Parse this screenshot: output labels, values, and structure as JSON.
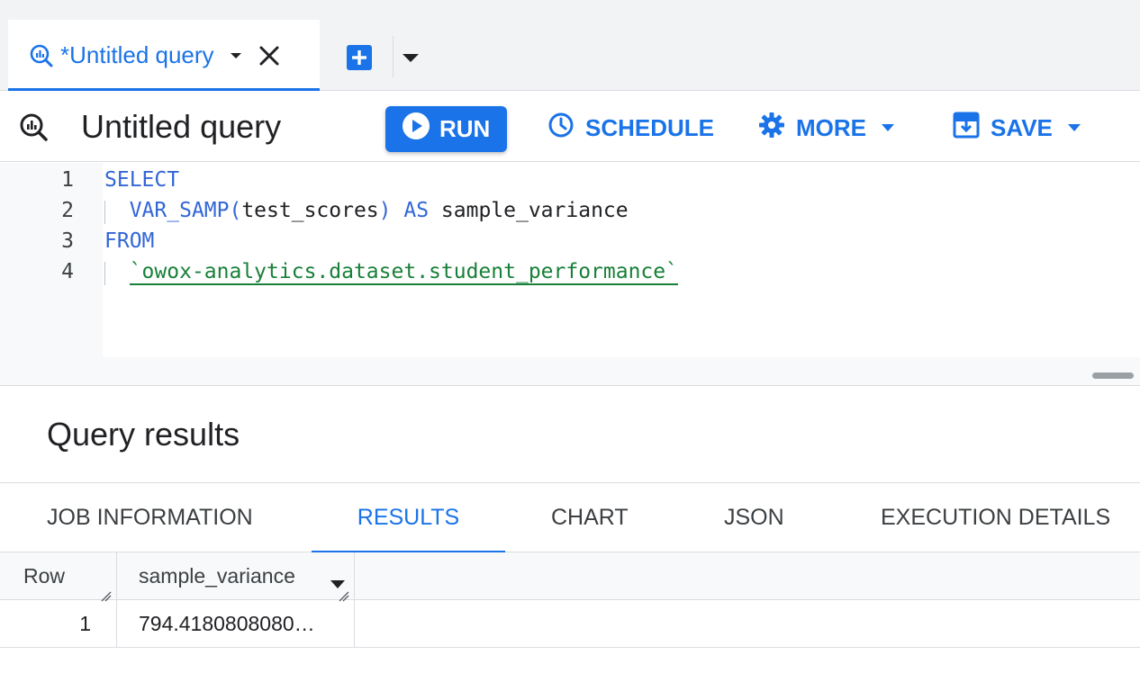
{
  "tabbar": {
    "tab_title": "*Untitled query",
    "icons": [
      "query-icon",
      "chevron-down-icon",
      "close-icon",
      "add-icon",
      "caret-down-icon"
    ]
  },
  "toolbar": {
    "title": "Untitled query",
    "run_label": "RUN",
    "schedule_label": "SCHEDULE",
    "more_label": "MORE",
    "save_label": "SAVE"
  },
  "editor": {
    "lines": [
      {
        "num": "1",
        "tokens": [
          {
            "t": "SELECT",
            "k": "kw"
          }
        ]
      },
      {
        "num": "2",
        "tokens": [
          {
            "t": "  "
          },
          {
            "t": "VAR_SAMP(",
            "k": "fn"
          },
          {
            "t": "test_scores",
            "k": "id"
          },
          {
            "t": ") ",
            "k": "fn"
          },
          {
            "t": "AS",
            "k": "kw"
          },
          {
            "t": " sample_variance",
            "k": "id"
          }
        ]
      },
      {
        "num": "3",
        "tokens": [
          {
            "t": "FROM",
            "k": "kw"
          }
        ]
      },
      {
        "num": "4",
        "tokens": [
          {
            "t": "  "
          },
          {
            "t": "`owox-analytics.dataset.student_performance`",
            "k": "str"
          }
        ]
      }
    ]
  },
  "results": {
    "title": "Query results",
    "tabs": [
      "JOB INFORMATION",
      "RESULTS",
      "CHART",
      "JSON",
      "EXECUTION DETAILS"
    ],
    "active_tab": "RESULTS",
    "columns": [
      "Row",
      "sample_variance"
    ],
    "rows": [
      {
        "row": "1",
        "sample_variance": "794.4180808080…"
      }
    ]
  },
  "colors": {
    "accent": "#1a73e8",
    "keyword": "#3367d6",
    "string": "#188038"
  }
}
